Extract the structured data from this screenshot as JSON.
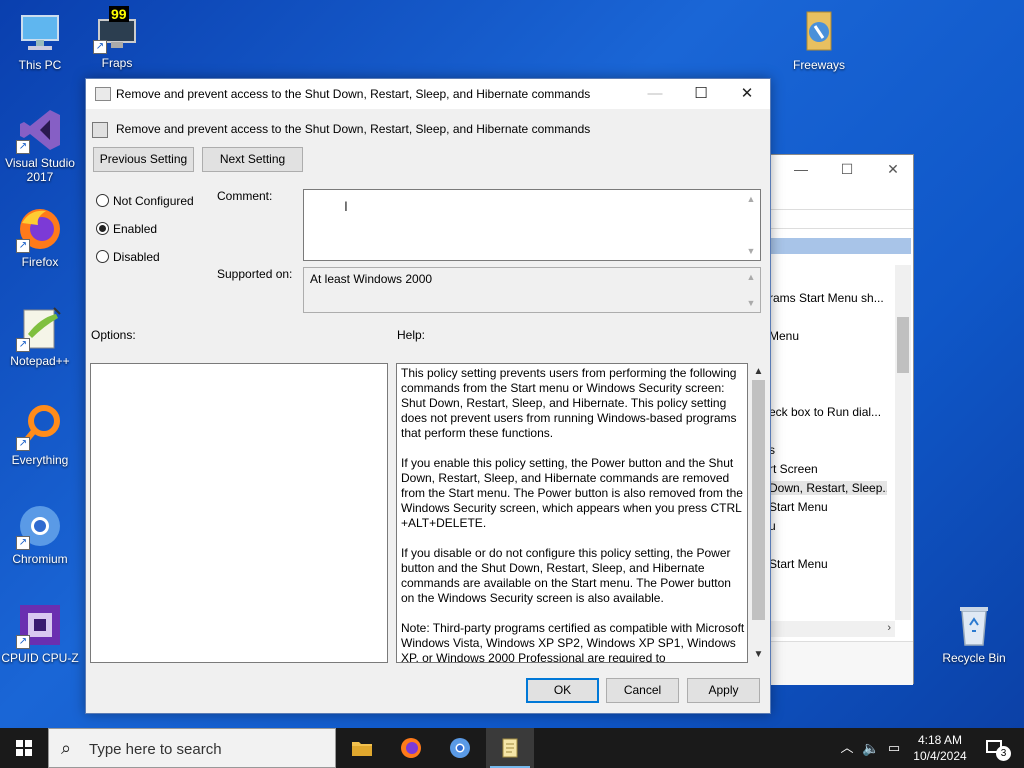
{
  "desktop": {
    "icons": [
      {
        "label": "This PC"
      },
      {
        "label": "Fraps"
      },
      {
        "label": "Freeways"
      },
      {
        "label": "Visual Studio 2017"
      },
      {
        "label": "Firefox"
      },
      {
        "label": "Notepad++"
      },
      {
        "label": "Everything"
      },
      {
        "label": "Chromium"
      },
      {
        "label": "CPUID CPU-Z"
      },
      {
        "label": "Recycle Bin"
      }
    ],
    "fraps_badge": "99"
  },
  "background_window": {
    "items": [
      "rams Start Menu sh...",
      "Menu",
      "eck box to Run dial...",
      "s",
      "rt Screen",
      "Down, Restart, Sleep...",
      "Start Menu",
      "u",
      "Start Menu"
    ],
    "selected_index": 5
  },
  "dialog": {
    "title": "Remove and prevent access to the Shut Down, Restart, Sleep, and Hibernate commands",
    "header_text": "Remove and prevent access to the Shut Down, Restart, Sleep, and Hibernate commands",
    "previous_setting": "Previous Setting",
    "next_setting": "Next Setting",
    "radios": {
      "not_configured": "Not Configured",
      "enabled": "Enabled",
      "disabled": "Disabled",
      "selected": "enabled"
    },
    "comment_label": "Comment:",
    "comment_value": "",
    "supported_label": "Supported on:",
    "supported_value": "At least Windows 2000",
    "options_label": "Options:",
    "help_label": "Help:",
    "help_paragraphs": [
      "This policy setting prevents users from performing the following commands from the Start menu or Windows Security screen: Shut Down, Restart, Sleep, and Hibernate. This policy setting does not prevent users from running Windows-based programs that perform these functions.",
      "If you enable this policy setting, the Power button and the Shut Down, Restart, Sleep, and Hibernate commands are removed from the Start menu. The Power button is also removed from the Windows Security screen, which appears when you press CTRL +ALT+DELETE.",
      "If you disable or do not configure this policy setting, the Power button and the Shut Down, Restart, Sleep, and Hibernate commands are available on the Start menu. The Power button on the Windows Security screen is also available.",
      "Note: Third-party programs certified as compatible with Microsoft Windows Vista, Windows XP SP2, Windows XP SP1, Windows XP, or Windows 2000 Professional are required to"
    ],
    "ok": "OK",
    "cancel": "Cancel",
    "apply": "Apply"
  },
  "taskbar": {
    "search_placeholder": "Type here to search",
    "time": "4:18 AM",
    "date": "10/4/2024",
    "notification_count": "3"
  },
  "colors": {
    "accent": "#0078d7",
    "desktop_bg": "#1a66d6",
    "taskbar_bg": "#1a1a1a"
  }
}
